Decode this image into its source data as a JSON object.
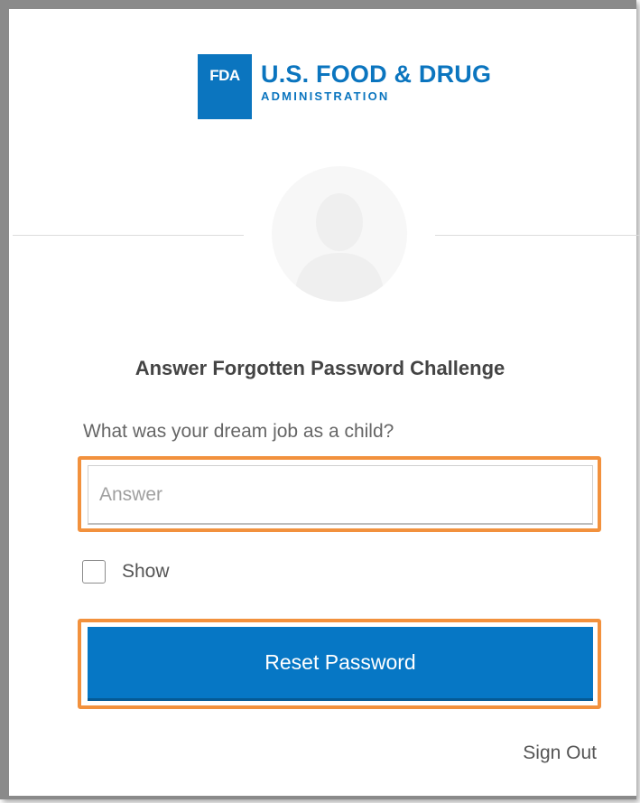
{
  "logo": {
    "mark": "FDA",
    "title": "U.S. FOOD & DRUG",
    "subtitle": "ADMINISTRATION",
    "color": "#0b75bf"
  },
  "avatar": {
    "icon": "user-silhouette-icon"
  },
  "form": {
    "title": "Answer Forgotten Password Challenge",
    "question": "What was your dream job as a child?",
    "answer_value": "",
    "answer_placeholder": "Answer",
    "show_label": "Show",
    "show_checked": false,
    "reset_label": "Reset Password",
    "button_color": "#0677c5",
    "highlight_color": "#f2913d"
  },
  "footer": {
    "sign_out_label": "Sign Out"
  }
}
